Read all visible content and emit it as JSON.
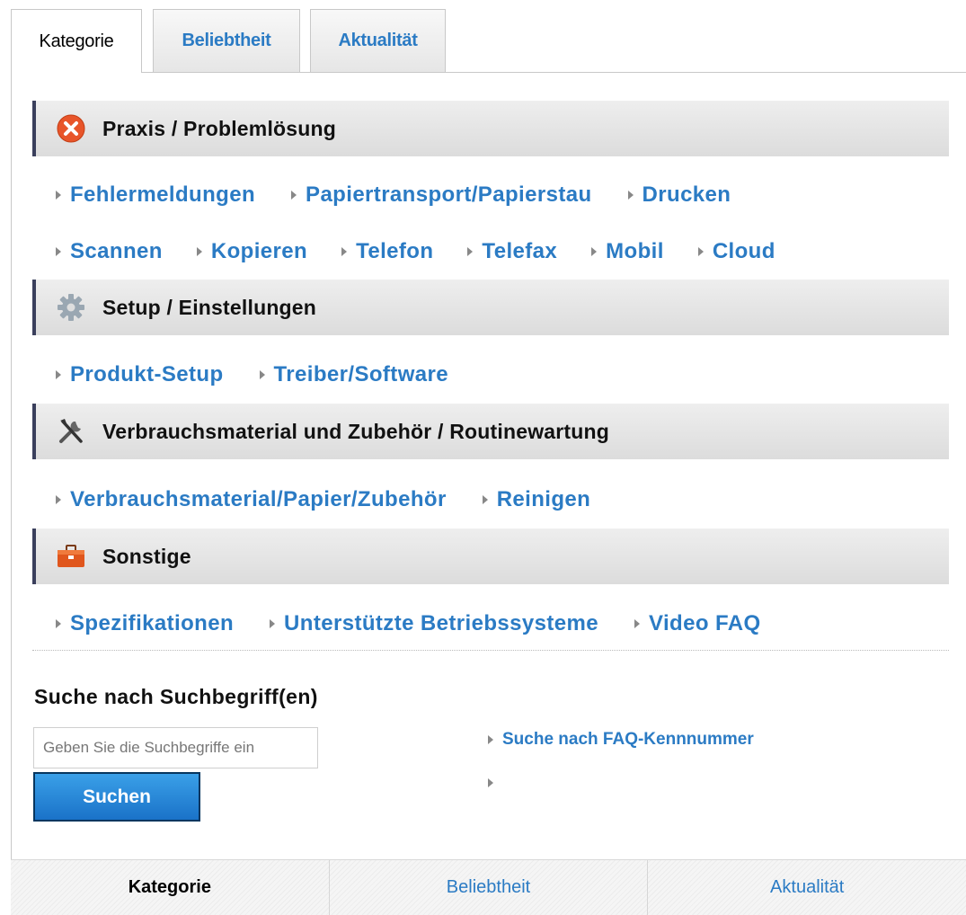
{
  "top_tabs": [
    {
      "label": "Kategorie",
      "active": true
    },
    {
      "label": "Beliebtheit",
      "active": false
    },
    {
      "label": "Aktualität",
      "active": false
    }
  ],
  "categories": [
    {
      "title": "Praxis / Problemlösung",
      "icon": "error-x-icon",
      "rows": [
        [
          "Fehlermeldungen",
          "Papiertransport/Papierstau",
          "Drucken"
        ],
        [
          "Scannen",
          "Kopieren",
          "Telefon",
          "Telefax",
          "Mobil",
          "Cloud"
        ]
      ]
    },
    {
      "title": "Setup / Einstellungen",
      "icon": "gear-icon",
      "rows": [
        [
          "Produkt-Setup",
          "Treiber/Software"
        ]
      ]
    },
    {
      "title": "Verbrauchsmaterial und Zubehör / Routinewartung",
      "icon": "tools-icon",
      "rows": [
        [
          "Verbrauchsmaterial/Papier/Zubehör",
          "Reinigen"
        ]
      ]
    },
    {
      "title": "Sonstige",
      "icon": "toolbox-icon",
      "rows": [
        [
          "Spezifikationen",
          "Unterstützte Betriebssysteme",
          "Video FAQ"
        ]
      ]
    }
  ],
  "search": {
    "title": "Suche nach Suchbegriff(en)",
    "placeholder": "Geben Sie die Suchbegriffe ein",
    "button_label": "Suchen",
    "faq_number_link": "Suche nach FAQ-Kennnummer"
  },
  "bottom_tabs": [
    {
      "label": "Kategorie",
      "active": true
    },
    {
      "label": "Beliebtheit",
      "active": false
    },
    {
      "label": "Aktualität",
      "active": false
    }
  ],
  "colors": {
    "link": "#2b7bc4",
    "header_bar": "#3a3f5c",
    "button": "#1a72c8",
    "error_icon": "#e8552a",
    "toolbox_icon": "#e0561d"
  }
}
